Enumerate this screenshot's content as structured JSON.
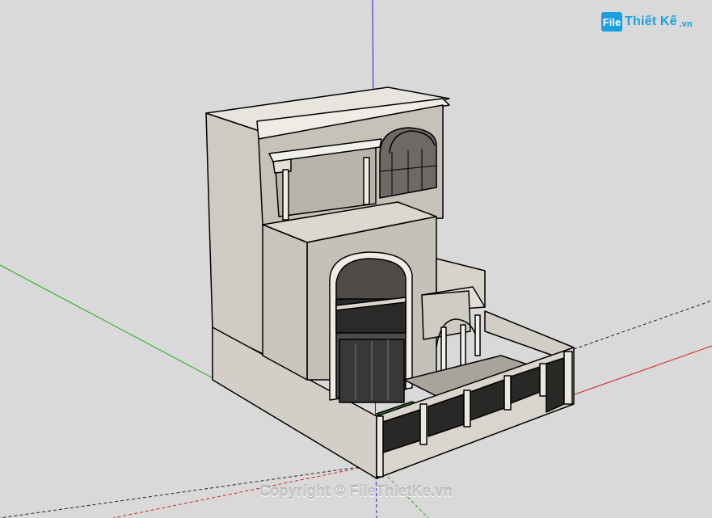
{
  "scene": {
    "background_color": "#d9d9d9",
    "axis_colors": {
      "red": "#d22222",
      "green": "#22aa22",
      "blue": "#2222cc"
    }
  },
  "logo": {
    "mark": "File",
    "text": "Thiết Kế",
    "sub": ".vn"
  },
  "watermark": {
    "text": "Copyright © FileThietKe.vn"
  }
}
